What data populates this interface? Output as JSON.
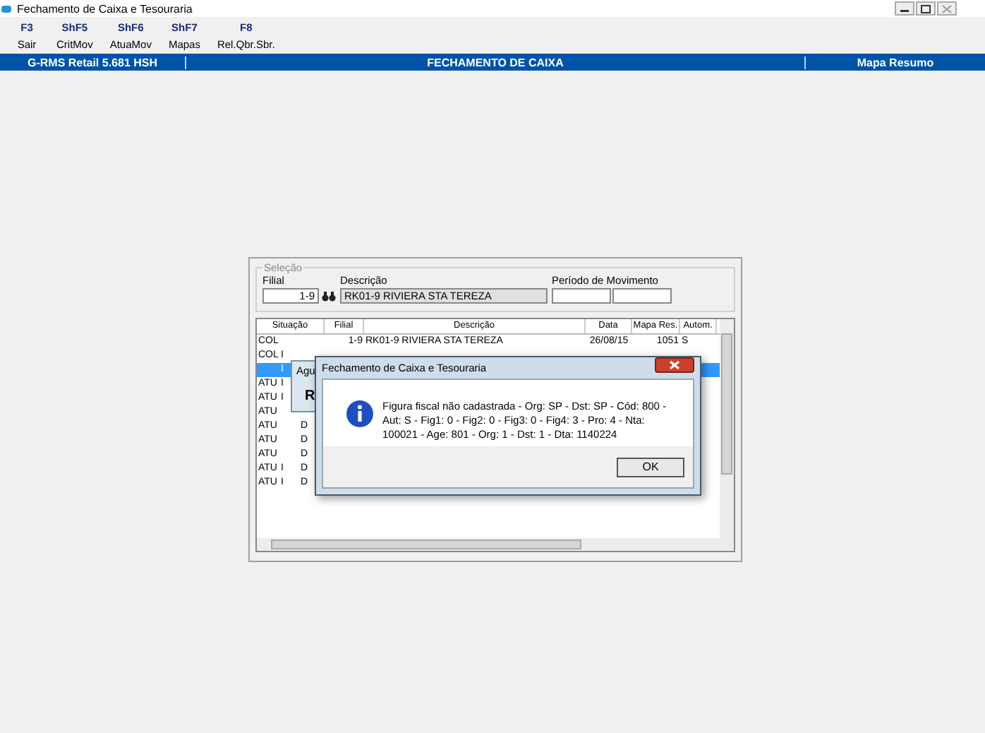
{
  "window": {
    "title": "Fechamento de Caixa e Tesouraria"
  },
  "toolbar": [
    {
      "key": "F3",
      "label": "Sair"
    },
    {
      "key": "ShF5",
      "label": "CritMov"
    },
    {
      "key": "ShF6",
      "label": "AtuaMov"
    },
    {
      "key": "ShF7",
      "label": "Mapas"
    },
    {
      "key": "F8",
      "label": "Rel.Qbr.Sbr."
    }
  ],
  "header_bar": {
    "left": "G-RMS Retail 5.681 HSH",
    "center": "FECHAMENTO DE CAIXA",
    "right": "Mapa Resumo"
  },
  "selection": {
    "legend": "Seleção",
    "filial_label": "Filial",
    "filial_value": "1-9",
    "descricao_label": "Descrição",
    "descricao_value": "RK01-9 RIVIERA STA TEREZA",
    "periodo_label": "Período de Movimento"
  },
  "table": {
    "columns": [
      "Situação",
      "Filial",
      "Descrição",
      "Data",
      "Mapa Res.",
      "Autom."
    ],
    "rows": [
      {
        "situacao": "COL",
        "flag": "",
        "type": "",
        "filial": "1-9",
        "descricao": "RK01-9 RIVIERA STA TEREZA",
        "data": "26/08/15",
        "mapa": "1051",
        "autom": "S",
        "selected": false
      },
      {
        "situacao": "COL",
        "flag": "I",
        "type": "",
        "filial": "",
        "descricao": "",
        "data": "",
        "mapa": "",
        "autom": "",
        "selected": false
      },
      {
        "situacao": "",
        "flag": "I",
        "type": "",
        "filial": "",
        "descricao": "",
        "data": "",
        "mapa": "",
        "autom": "",
        "selected": true
      },
      {
        "situacao": "ATU",
        "flag": "I",
        "type": "",
        "filial": "",
        "descricao": "",
        "data": "",
        "mapa": "",
        "autom": "",
        "selected": false
      },
      {
        "situacao": "ATU",
        "flag": "I",
        "type": "",
        "filial": "",
        "descricao": "",
        "data": "",
        "mapa": "",
        "autom": "",
        "selected": false
      },
      {
        "situacao": "ATU",
        "flag": "",
        "type": "",
        "filial": "",
        "descricao": "",
        "data": "",
        "mapa": "",
        "autom": "",
        "selected": false
      },
      {
        "situacao": "ATU",
        "flag": "",
        "type": "D",
        "filial": "",
        "descricao": "",
        "data": "",
        "mapa": "",
        "autom": "",
        "selected": false
      },
      {
        "situacao": "ATU",
        "flag": "",
        "type": "D",
        "filial": "",
        "descricao": "",
        "data": "",
        "mapa": "",
        "autom": "",
        "selected": false
      },
      {
        "situacao": "ATU",
        "flag": "",
        "type": "D",
        "filial": "",
        "descricao": "",
        "data": "",
        "mapa": "",
        "autom": "",
        "selected": false
      },
      {
        "situacao": "ATU",
        "flag": "I",
        "type": "D",
        "filial": "",
        "descricao": "",
        "data": "",
        "mapa": "",
        "autom": "",
        "selected": false
      },
      {
        "situacao": "ATU",
        "flag": "I",
        "type": "D",
        "filial": "",
        "descricao": "",
        "data": "",
        "mapa": "",
        "autom": "",
        "selected": false
      }
    ]
  },
  "wait_window": {
    "title": "Agu",
    "text": "R"
  },
  "dialog": {
    "title": "Fechamento de Caixa e Tesouraria",
    "message": "Figura fiscal não cadastrada - Org: SP - Dst: SP - Cód: 800 - Aut: S - Fig1: 0 - Fig2: 0 - Fig3: 0 - Fig4: 3 - Pro: 4 - Nta: 100021 - Age: 801 - Org: 1 - Dst: 1 - Dta: 1140224",
    "button": "OK"
  }
}
